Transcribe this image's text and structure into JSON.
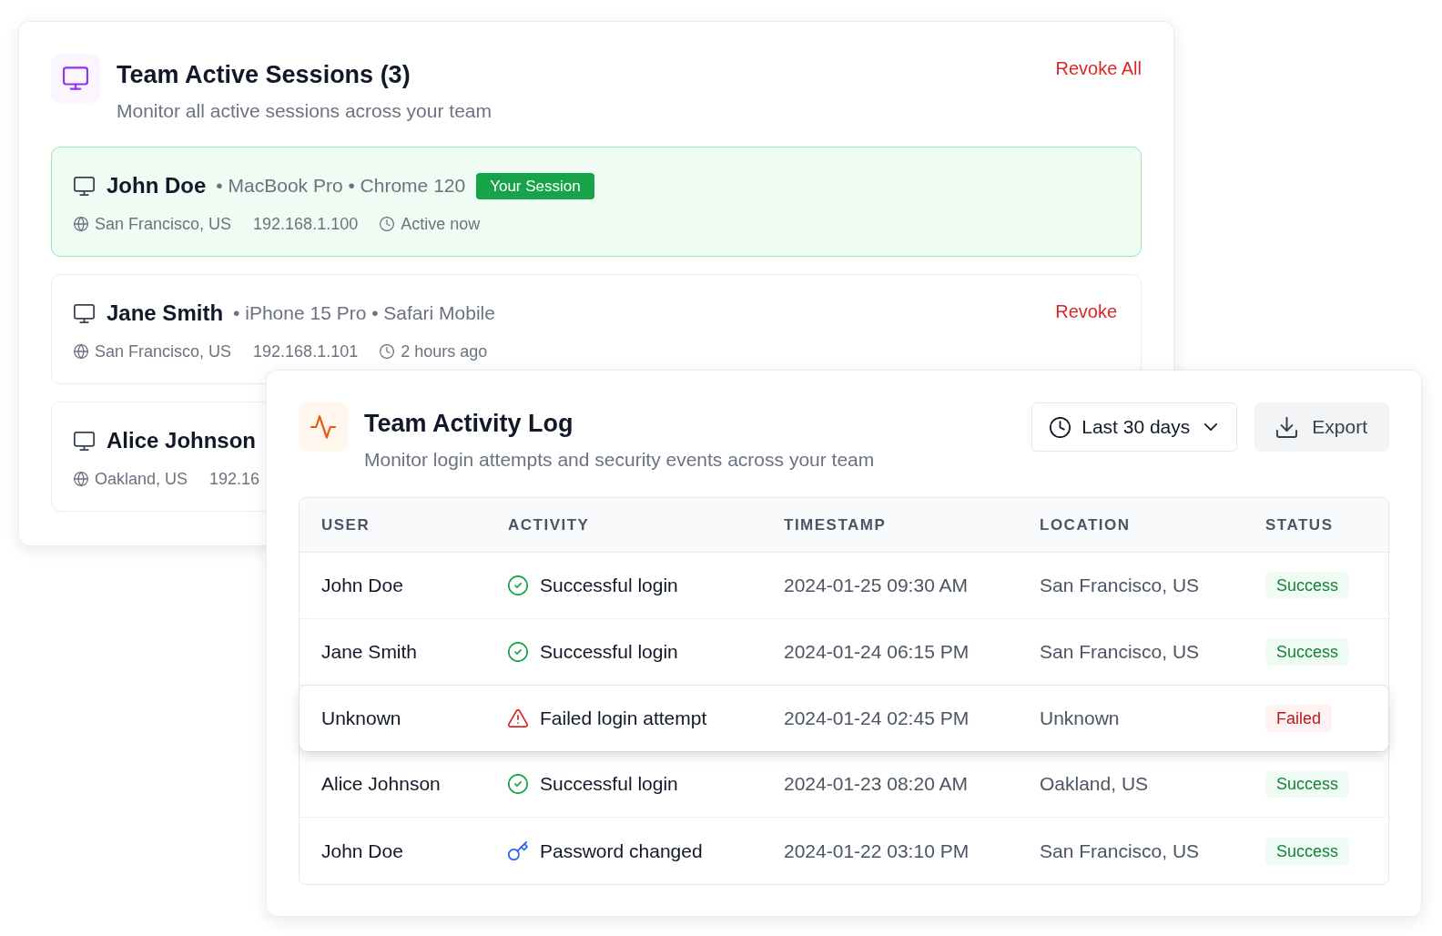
{
  "sessions": {
    "title": "Team Active Sessions (3)",
    "subtitle": "Monitor all active sessions across your team",
    "revoke_all": "Revoke All",
    "items": [
      {
        "name": "John Doe",
        "details": "• MacBook Pro • Chrome 120",
        "current": true,
        "badge": "Your Session",
        "location": "San Francisco, US",
        "ip": "192.168.1.100",
        "last_active": "Active now"
      },
      {
        "name": "Jane Smith",
        "details": "• iPhone 15 Pro • Safari Mobile",
        "current": false,
        "action": "Revoke",
        "location": "San Francisco, US",
        "ip": "192.168.1.101",
        "last_active": "2 hours ago"
      },
      {
        "name": "Alice Johnson",
        "current": false,
        "location": "Oakland, US",
        "ip": "192.16"
      }
    ]
  },
  "activity_log": {
    "title": "Team Activity Log",
    "subtitle": "Monitor login attempts and security events across your team",
    "range_select": {
      "value": "Last 30 days"
    },
    "export_button": {
      "label": "Export"
    },
    "table": {
      "columns": [
        "USER",
        "ACTIVITY",
        "TIMESTAMP",
        "LOCATION",
        "STATUS"
      ],
      "rows": [
        {
          "user": "John Doe",
          "kind": "login_success",
          "activity": "Successful login",
          "timestamp": "2024-01-25 09:30 AM",
          "location": "San Francisco, US",
          "status": {
            "label": "Success",
            "kind": "success"
          },
          "selected": false
        },
        {
          "user": "Jane Smith",
          "kind": "login_success",
          "activity": "Successful login",
          "timestamp": "2024-01-24 06:15 PM",
          "location": "San Francisco, US",
          "status": {
            "label": "Success",
            "kind": "success"
          },
          "selected": false
        },
        {
          "user": "Unknown",
          "kind": "login_failed",
          "activity": "Failed login attempt",
          "timestamp": "2024-01-24 02:45 PM",
          "location": "Unknown",
          "status": {
            "label": "Failed",
            "kind": "failed"
          },
          "selected": true
        },
        {
          "user": "Alice Johnson",
          "kind": "login_success",
          "activity": "Successful login",
          "timestamp": "2024-01-23 08:20 AM",
          "location": "Oakland, US",
          "status": {
            "label": "Success",
            "kind": "success"
          },
          "selected": false
        },
        {
          "user": "John Doe",
          "kind": "password_change",
          "activity": "Password changed",
          "timestamp": "2024-01-22 03:10 PM",
          "location": "San Francisco, US",
          "status": {
            "label": "Success",
            "kind": "success"
          },
          "selected": false
        }
      ]
    }
  }
}
